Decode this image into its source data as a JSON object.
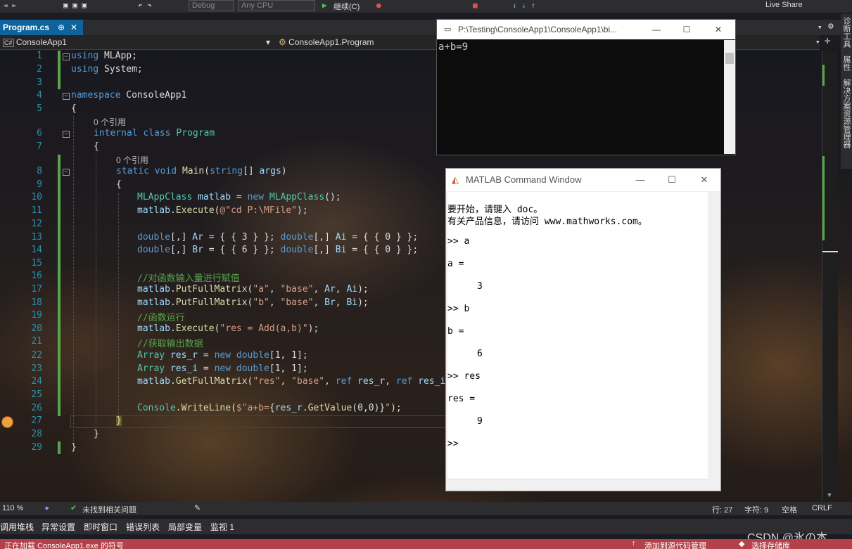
{
  "toolbar": {
    "config": "Debug",
    "platform": "Any CPU",
    "continue_label": "继续(C)",
    "live_share": "Live Share"
  },
  "editor": {
    "tab_title": "Program.cs",
    "tab_pin": "⊕",
    "tab_close": "✕",
    "nav_project": "ConsoleApp1",
    "nav_class": "ConsoleApp1.Program",
    "line_numbers": [
      "1",
      "2",
      "3",
      "4",
      "5",
      "6",
      "7",
      "8",
      "9",
      "10",
      "11",
      "12",
      "13",
      "14",
      "15",
      "16",
      "17",
      "18",
      "19",
      "20",
      "21",
      "22",
      "23",
      "24",
      "25",
      "26",
      "27",
      "28",
      "29"
    ],
    "codelens_class": "0 个引用",
    "codelens_main": "0 个引用"
  },
  "console": {
    "title": "P:\\Testing\\ConsoleApp1\\ConsoleApp1\\bi...",
    "output": "a+b=9"
  },
  "matlab": {
    "title": "MATLAB Command Window",
    "intro1": "要开始，请键入 doc。",
    "intro2": "有关产品信息，请访问 www.mathworks.com。",
    "lines": [
      ">> a",
      "a =",
      "3",
      ">> b",
      "b =",
      "6",
      ">> res",
      "res =",
      "9",
      ">>"
    ]
  },
  "statusbar": {
    "zoom": "110 %",
    "issues": "未找到相关问题",
    "line": "行: 27",
    "col": "字符: 9",
    "space": "空格",
    "eol": "CRLF"
  },
  "bottom_tabs": [
    "调用堆栈",
    "异常设置",
    "即时窗口",
    "错误列表",
    "局部变量",
    "监视 1"
  ],
  "footer": {
    "loading": "正在加载 ConsoleApp1.exe 的符号",
    "source_control": "添加到源代码管理",
    "repo": "选择存储库"
  },
  "side_panel": {
    "labels": [
      "诊断工具",
      "属性",
      "解决方案资源管理器"
    ]
  },
  "watermark": "CSDN @氷の本",
  "colors": {
    "accent": "#0e639c",
    "footer": "#b4404a",
    "change_bar": "#57a64a"
  }
}
